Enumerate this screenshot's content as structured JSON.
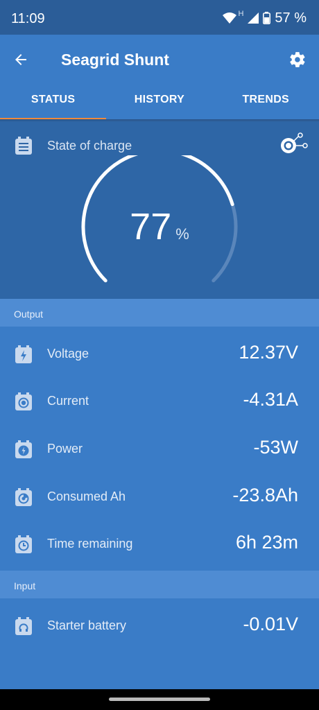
{
  "status_bar": {
    "time": "11:09",
    "network_badge": "H",
    "battery_percent": "57 %",
    "icons": [
      "wifi-icon",
      "signal-icon",
      "battery-icon"
    ]
  },
  "app_bar": {
    "title": "Seagrid Shunt",
    "back_icon": "back-arrow-icon",
    "settings_icon": "gear-icon"
  },
  "tabs": [
    {
      "label": "STATUS",
      "selected": true
    },
    {
      "label": "HISTORY",
      "selected": false
    },
    {
      "label": "TRENDS",
      "selected": false
    }
  ],
  "state_of_charge": {
    "label": "State of charge",
    "value": "77",
    "unit": "%",
    "fraction": 0.77
  },
  "sections": {
    "output": "Output",
    "input": "Input"
  },
  "output_rows": [
    {
      "label": "Voltage",
      "value": "12.37V",
      "icon": "voltage-icon"
    },
    {
      "label": "Current",
      "value": "-4.31A",
      "icon": "current-icon"
    },
    {
      "label": "Power",
      "value": "-53W",
      "icon": "power-icon"
    },
    {
      "label": "Consumed Ah",
      "value": "-23.8Ah",
      "icon": "consumed-icon"
    },
    {
      "label": "Time remaining",
      "value": "6h 23m",
      "icon": "clock-icon"
    }
  ],
  "input_rows": [
    {
      "label": "Starter battery",
      "value": "-0.01V",
      "icon": "starter-battery-icon"
    }
  ],
  "colors": {
    "status_bar": "#2b5d98",
    "primary": "#3a7cc7",
    "card": "#2e66a6",
    "section_header": "#4f8cd3",
    "tab_indicator": "#f08a3c"
  }
}
